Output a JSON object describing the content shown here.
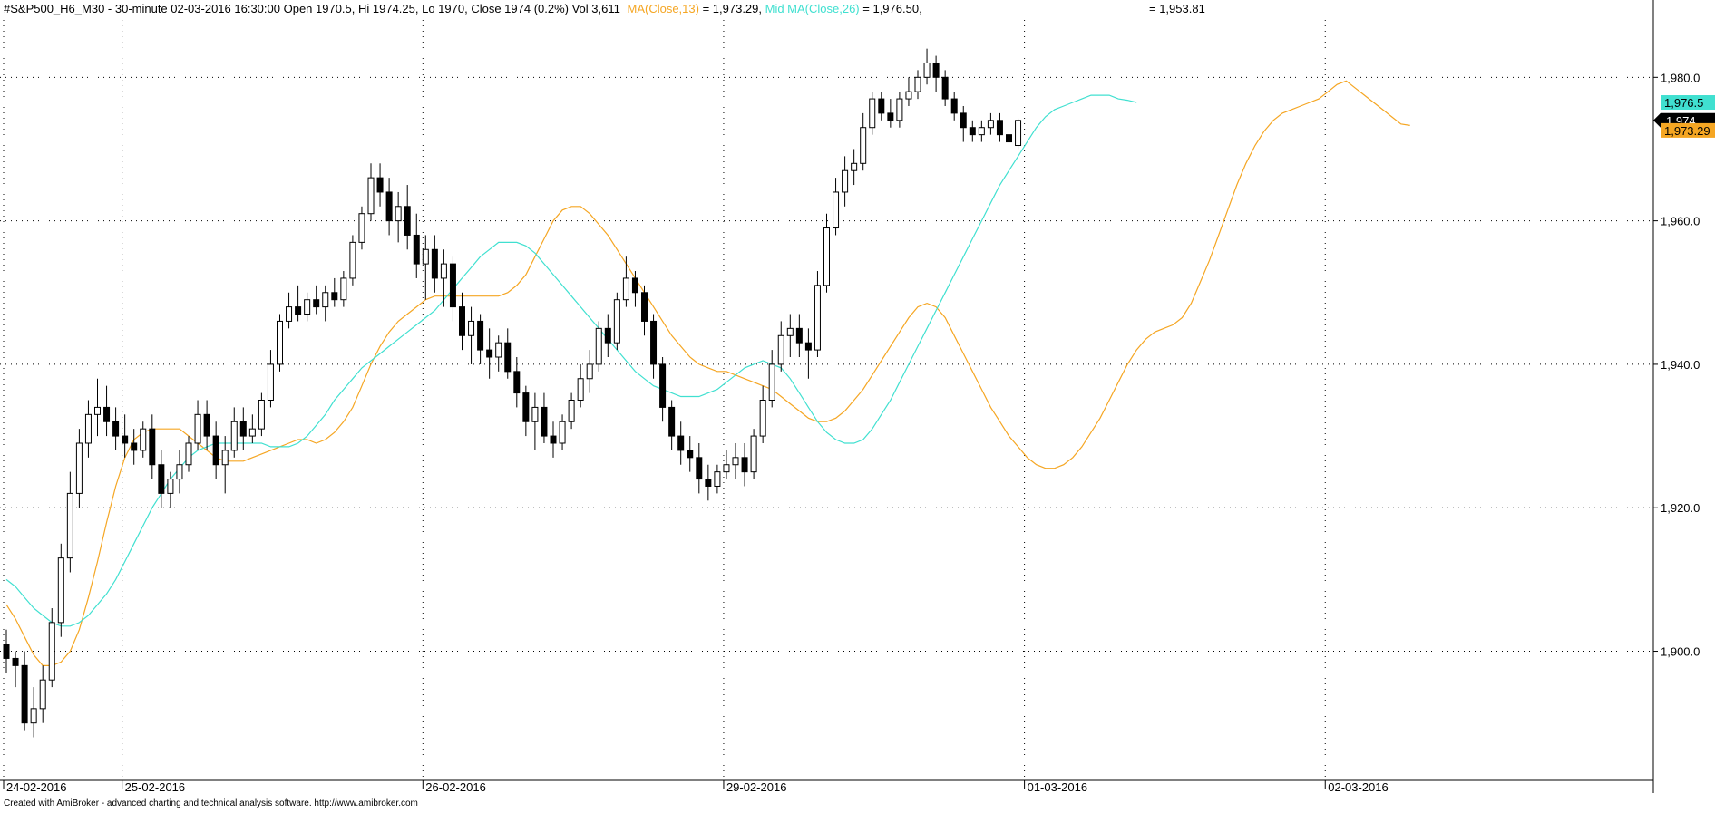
{
  "header": {
    "title": "#S&P500_H6_M30 - 30-minute 02-03-2016 16:30:00 Open 1970.5, Hi 1974.25, Lo 1970, Close 1974 (0.2%) Vol 3,611",
    "ma13_label": "MA(Close,13)",
    "ma13_value": " = 1,973.29, ",
    "mid_label": "Mid MA(Close,26)",
    "mid_value": " = 1,976.50,",
    "extra_value": "= 1,953.81"
  },
  "footer": {
    "credit": "Created with AmiBroker - advanced charting and technical analysis software. http://www.amibroker.com"
  },
  "colors": {
    "background": "#ffffff",
    "grid": "#000000",
    "candle_up_fill": "#ffffff",
    "candle_down_fill": "#000000",
    "ma13": "#f5a623",
    "ma26": "#40e0d0",
    "last_price_bg": "#000000",
    "ma26_badge_bg": "#40e0d0",
    "ma13_badge_bg": "#f5a623"
  },
  "chart_data": {
    "type": "candlestick",
    "title": "#S&P500_H6_M30 - 30-minute",
    "ylim": [
      1882,
      1988
    ],
    "y_ticks": [
      1900,
      1920,
      1940,
      1960,
      1980
    ],
    "y_tick_labels": [
      "1,900.0",
      "1,920.0",
      "1,940.0",
      "1,960.0",
      "1,980.0"
    ],
    "date_labels": [
      {
        "bar": 0,
        "label": "24-02-2016"
      },
      {
        "bar": 13,
        "label": "25-02-2016"
      },
      {
        "bar": 46,
        "label": "26-02-2016"
      },
      {
        "bar": 79,
        "label": "29-02-2016"
      },
      {
        "bar": 112,
        "label": "01-03-2016"
      },
      {
        "bar": 145,
        "label": "02-03-2016"
      }
    ],
    "grid": true,
    "last_price_badge": "1,974",
    "ma26_badge": "1,976.5",
    "ma13_badge": "1,973.29",
    "series": [
      {
        "name": "MA(Close,13)",
        "color": "#f5a623",
        "values": [
          1906.5,
          1904.5,
          1902.0,
          1899.5,
          1898.0,
          1898.0,
          1898.5,
          1900.0,
          1903.0,
          1907.5,
          1912.5,
          1918.0,
          1923.0,
          1927.0,
          1929.5,
          1930.5,
          1931.0,
          1931.0,
          1931.0,
          1931.0,
          1930.0,
          1929.0,
          1928.0,
          1927.0,
          1926.5,
          1926.5,
          1926.5,
          1927.0,
          1927.5,
          1928.0,
          1928.5,
          1929.0,
          1929.5,
          1929.5,
          1929.0,
          1929.5,
          1930.5,
          1932.0,
          1934.0,
          1937.0,
          1940.0,
          1942.5,
          1944.5,
          1946.0,
          1947.0,
          1948.0,
          1949.0,
          1949.5,
          1949.5,
          1949.5,
          1949.5,
          1949.5,
          1949.5,
          1949.5,
          1949.5,
          1950.0,
          1951.0,
          1952.5,
          1955.0,
          1957.5,
          1960.0,
          1961.5,
          1962.0,
          1962.0,
          1961.0,
          1959.5,
          1958.0,
          1956.0,
          1954.0,
          1952.0,
          1950.0,
          1948.0,
          1946.0,
          1944.0,
          1942.5,
          1941.0,
          1940.0,
          1939.5,
          1939.0,
          1939.0,
          1938.5,
          1938.0,
          1937.5,
          1937.0,
          1936.5,
          1935.5,
          1934.5,
          1933.5,
          1932.5,
          1932.0,
          1932.0,
          1932.5,
          1933.5,
          1935.0,
          1936.5,
          1938.5,
          1940.5,
          1942.5,
          1944.5,
          1946.5,
          1948.0,
          1948.5,
          1948.0,
          1946.5,
          1944.0,
          1941.5,
          1939.0,
          1936.5,
          1934.0,
          1932.0,
          1930.0,
          1928.5,
          1927.0,
          1926.0,
          1925.5,
          1925.5,
          1926.0,
          1927.0,
          1928.5,
          1930.5,
          1932.5,
          1935.0,
          1937.5,
          1940.0,
          1942.0,
          1943.5,
          1944.5,
          1945.0,
          1945.5,
          1946.5,
          1948.5,
          1951.5,
          1954.5,
          1958.0,
          1961.5,
          1965.0,
          1968.0,
          1970.5,
          1972.5,
          1974.0,
          1975.0,
          1975.5,
          1976.0,
          1976.5,
          1977.0,
          1978.0,
          1979.0,
          1979.5,
          1978.5,
          1977.5,
          1976.5,
          1975.5,
          1974.5,
          1973.5,
          1973.3
        ]
      },
      {
        "name": "Mid MA(Close,26)",
        "color": "#40e0d0",
        "values": [
          1910.0,
          1909.0,
          1907.5,
          1906.0,
          1905.0,
          1904.0,
          1903.5,
          1903.5,
          1904.0,
          1905.0,
          1906.5,
          1908.0,
          1910.0,
          1912.5,
          1915.0,
          1917.5,
          1920.0,
          1922.0,
          1924.0,
          1925.5,
          1927.0,
          1928.0,
          1928.5,
          1929.0,
          1929.0,
          1929.0,
          1929.0,
          1929.0,
          1929.0,
          1928.5,
          1928.5,
          1928.5,
          1929.0,
          1930.0,
          1931.5,
          1933.0,
          1935.0,
          1936.5,
          1938.0,
          1939.5,
          1940.5,
          1941.5,
          1942.5,
          1943.5,
          1944.5,
          1945.5,
          1946.5,
          1947.5,
          1949.0,
          1950.5,
          1952.0,
          1953.5,
          1955.0,
          1956.0,
          1957.0,
          1957.0,
          1957.0,
          1956.5,
          1955.5,
          1954.0,
          1952.5,
          1951.0,
          1949.5,
          1948.0,
          1946.5,
          1945.0,
          1943.5,
          1942.0,
          1940.5,
          1939.0,
          1938.0,
          1937.0,
          1936.5,
          1936.0,
          1935.5,
          1935.5,
          1935.5,
          1936.0,
          1936.5,
          1937.5,
          1938.5,
          1939.5,
          1940.0,
          1940.5,
          1940.0,
          1939.5,
          1938.0,
          1936.0,
          1934.0,
          1932.0,
          1930.5,
          1929.5,
          1929.0,
          1929.0,
          1929.5,
          1931.0,
          1933.0,
          1935.0,
          1937.5,
          1940.0,
          1942.5,
          1945.0,
          1947.5,
          1950.0,
          1952.5,
          1955.0,
          1957.5,
          1960.0,
          1962.5,
          1965.0,
          1967.0,
          1969.0,
          1971.0,
          1973.0,
          1974.5,
          1975.5,
          1976.0,
          1976.5,
          1977.0,
          1977.5,
          1977.5,
          1977.5,
          1977.0,
          1976.8,
          1976.5
        ]
      }
    ],
    "candles": [
      [
        1901,
        1903,
        1897,
        1899
      ],
      [
        1899,
        1900,
        1895,
        1898
      ],
      [
        1898,
        1900,
        1889,
        1890
      ],
      [
        1890,
        1895,
        1888,
        1892
      ],
      [
        1892,
        1898,
        1890,
        1896
      ],
      [
        1896,
        1906,
        1895,
        1904
      ],
      [
        1904,
        1915,
        1902,
        1913
      ],
      [
        1913,
        1925,
        1911,
        1922
      ],
      [
        1922,
        1931,
        1920,
        1929
      ],
      [
        1929,
        1935,
        1927,
        1933
      ],
      [
        1933,
        1938,
        1930,
        1934
      ],
      [
        1934,
        1937,
        1930,
        1932
      ],
      [
        1932,
        1934,
        1928,
        1930
      ],
      [
        1930,
        1933,
        1927,
        1929
      ],
      [
        1929,
        1931,
        1926,
        1928
      ],
      [
        1928,
        1932,
        1927,
        1931
      ],
      [
        1931,
        1933,
        1924,
        1926
      ],
      [
        1926,
        1928,
        1920,
        1922
      ],
      [
        1922,
        1925,
        1920,
        1924
      ],
      [
        1924,
        1928,
        1922,
        1926
      ],
      [
        1926,
        1930,
        1925,
        1929
      ],
      [
        1929,
        1935,
        1928,
        1933
      ],
      [
        1933,
        1935,
        1928,
        1930
      ],
      [
        1930,
        1932,
        1924,
        1926
      ],
      [
        1926,
        1930,
        1922,
        1928
      ],
      [
        1928,
        1934,
        1927,
        1932
      ],
      [
        1932,
        1934,
        1928,
        1930
      ],
      [
        1930,
        1933,
        1929,
        1931
      ],
      [
        1931,
        1936,
        1930,
        1935
      ],
      [
        1935,
        1942,
        1934,
        1940
      ],
      [
        1940,
        1947,
        1939,
        1946
      ],
      [
        1946,
        1950,
        1945,
        1948
      ],
      [
        1948,
        1951,
        1946,
        1947
      ],
      [
        1947,
        1950,
        1946,
        1949
      ],
      [
        1949,
        1951,
        1947,
        1948
      ],
      [
        1948,
        1951,
        1946,
        1950
      ],
      [
        1950,
        1952,
        1948,
        1949
      ],
      [
        1949,
        1953,
        1948,
        1952
      ],
      [
        1952,
        1958,
        1951,
        1957
      ],
      [
        1957,
        1962,
        1956,
        1961
      ],
      [
        1961,
        1968,
        1960,
        1966
      ],
      [
        1966,
        1968,
        1962,
        1964
      ],
      [
        1964,
        1966,
        1958,
        1960
      ],
      [
        1960,
        1964,
        1957,
        1962
      ],
      [
        1962,
        1965,
        1956,
        1958
      ],
      [
        1958,
        1961,
        1952,
        1954
      ],
      [
        1954,
        1958,
        1949,
        1956
      ],
      [
        1956,
        1958,
        1950,
        1952
      ],
      [
        1952,
        1956,
        1948,
        1954
      ],
      [
        1954,
        1955,
        1946,
        1948
      ],
      [
        1948,
        1950,
        1942,
        1944
      ],
      [
        1944,
        1948,
        1940,
        1946
      ],
      [
        1946,
        1947,
        1940,
        1942
      ],
      [
        1942,
        1945,
        1938,
        1941
      ],
      [
        1941,
        1944,
        1939,
        1943
      ],
      [
        1943,
        1945,
        1938,
        1939
      ],
      [
        1939,
        1941,
        1934,
        1936
      ],
      [
        1936,
        1937,
        1930,
        1932
      ],
      [
        1932,
        1936,
        1928,
        1934
      ],
      [
        1934,
        1936,
        1929,
        1930
      ],
      [
        1930,
        1932,
        1927,
        1929
      ],
      [
        1929,
        1933,
        1928,
        1932
      ],
      [
        1932,
        1936,
        1931,
        1935
      ],
      [
        1935,
        1940,
        1934,
        1938
      ],
      [
        1938,
        1942,
        1936,
        1940
      ],
      [
        1940,
        1946,
        1939,
        1945
      ],
      [
        1945,
        1947,
        1941,
        1943
      ],
      [
        1943,
        1950,
        1942,
        1949
      ],
      [
        1949,
        1955,
        1948,
        1952
      ],
      [
        1952,
        1953,
        1948,
        1950
      ],
      [
        1950,
        1951,
        1944,
        1946
      ],
      [
        1946,
        1947,
        1938,
        1940
      ],
      [
        1940,
        1941,
        1932,
        1934
      ],
      [
        1934,
        1935,
        1928,
        1930
      ],
      [
        1930,
        1932,
        1926,
        1928
      ],
      [
        1928,
        1930,
        1925,
        1927
      ],
      [
        1927,
        1929,
        1922,
        1924
      ],
      [
        1924,
        1926,
        1921,
        1923
      ],
      [
        1923,
        1926,
        1922,
        1925
      ],
      [
        1925,
        1928,
        1924,
        1926
      ],
      [
        1926,
        1929,
        1924,
        1927
      ],
      [
        1927,
        1929,
        1923,
        1925
      ],
      [
        1925,
        1931,
        1924,
        1930
      ],
      [
        1930,
        1937,
        1929,
        1935
      ],
      [
        1935,
        1942,
        1934,
        1940
      ],
      [
        1940,
        1946,
        1939,
        1944
      ],
      [
        1944,
        1947,
        1941,
        1945
      ],
      [
        1945,
        1947,
        1941,
        1943
      ],
      [
        1943,
        1945,
        1938,
        1942
      ],
      [
        1942,
        1953,
        1941,
        1951
      ],
      [
        1951,
        1961,
        1950,
        1959
      ],
      [
        1959,
        1966,
        1958,
        1964
      ],
      [
        1964,
        1969,
        1962,
        1967
      ],
      [
        1967,
        1970,
        1965,
        1968
      ],
      [
        1968,
        1975,
        1967,
        1973
      ],
      [
        1973,
        1978,
        1972,
        1977
      ],
      [
        1977,
        1978,
        1974,
        1975
      ],
      [
        1975,
        1977,
        1973,
        1974
      ],
      [
        1974,
        1978,
        1973,
        1977
      ],
      [
        1977,
        1980,
        1976,
        1978
      ],
      [
        1978,
        1981,
        1977,
        1980
      ],
      [
        1980,
        1984,
        1979,
        1982
      ],
      [
        1982,
        1983,
        1978,
        1980
      ],
      [
        1980,
        1981,
        1976,
        1977
      ],
      [
        1977,
        1978,
        1974,
        1975
      ],
      [
        1975,
        1976,
        1971,
        1973
      ],
      [
        1973,
        1974,
        1971,
        1972
      ],
      [
        1972,
        1974,
        1971,
        1973
      ],
      [
        1973,
        1975,
        1972,
        1974
      ],
      [
        1974,
        1975,
        1971,
        1972
      ],
      [
        1972,
        1973,
        1970,
        1971
      ],
      [
        1970.5,
        1974.25,
        1970,
        1974
      ]
    ]
  }
}
